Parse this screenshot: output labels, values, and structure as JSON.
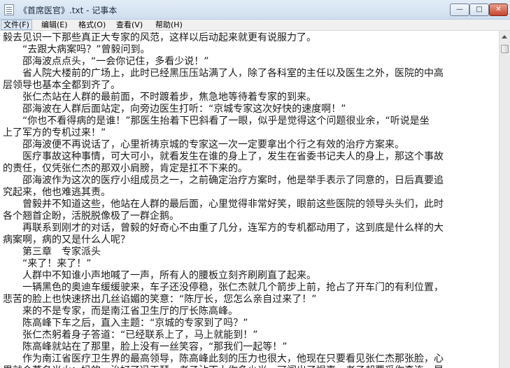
{
  "window": {
    "title": "《首席医官》.txt - 记事本"
  },
  "title_buttons": {
    "minimize": "—",
    "maximize": "□",
    "close": "✕"
  },
  "menu": {
    "items": [
      {
        "label": "文件(F)"
      },
      {
        "label": "编辑(E)"
      },
      {
        "label": "格式(O)"
      },
      {
        "label": "查看(V)"
      },
      {
        "label": "帮助(H)"
      }
    ]
  },
  "editor": {
    "lines": [
      "毅去见识一下那些真正大专家的风范，这样以后动起来就更有说服力了。",
      "　　“去跟大病案吗？”曾毅问到。",
      "　　邵海波点点头，“一会你记住，多看少说！”",
      "　　省人院大楼前的广场上，此时已经黑压压站满了人，除了各科室的主任以及医生之外，医院的中高",
      "层领导也基本全都到齐了。",
      "　　张仁杰站在人群的最前面，不时踱着步，焦急地等待着专家的到来。",
      "　　邵海波在人群后面站定，向旁边医生打听：“京城专家这次好快的速度啊！”",
      "　　“你也不看得病的是谁！”那医生抬着下巴斜看了一眼，似乎是觉得这个问题很业余，“听说是坐",
      "上了军方的专机过来！”",
      "　　邵海波便不再说话了，心里祈祷京城的专家这一次一定要拿出个行之有效的治疗方案来。",
      "　　医疗事故这种事情，可大可小，就看发生在谁的身上了，发生在省委书记夫人的身上，那这个事故",
      "的责任，仅凭张仁杰的那双小肩膀，肯定是扛不下来的。",
      "　　邵海波作为这次的医疗小组成员之一，之前确定治疗方案时，他是举手表示了同意的，日后真要追",
      "究起来，他也难逃其责。",
      "　　曾毅并不知道这些，他站在人群的最后面，心里觉得非常好笑，眼前这些医院的领导头头们，此时",
      "各个翘首企盼，活脱脱像极了一群企鹅。",
      "　　再联系到刚才的对话，曾毅的好奇心不由重了几分，连军方的专机都动用了，这到底是什么样的大",
      "病案啊，病的又是什么人呢？",
      "　　第三章　专家派头",
      "　　“来了！来了！”",
      "　　人群中不知谁小声地喊了一声，所有人的腰板立刻齐刷刷直了起来。",
      "　　一辆黑色的奥迪车缓缓驶来，车子还没停稳，张仁杰就几个箭步上前，抢占了开车门的有利位置，",
      "悲苦的脸上也快速挤出几丝谄媚的笑意：“陈厅长，您怎么亲自过来了！”",
      "　　来的不是专家，而是南江省卫生厅的厅长陈高峰。",
      "　　陈高峰下车之后，直入主题：“京城的专家到了吗？”",
      "　　张仁杰躬着身子答道：“已经联系上了，马上就能到！”",
      "　　陈高峰就站在了那里，脸上没有一丝笑容，“那我们一起等！”",
      "　　作为南江省医疗卫生界的最高领导，陈高峰此刻的压力也很大，他现在只要看见张仁杰那张脸，心",
      "里就会莫名光火：妈的，治好了冯玉琴，老子沾不上你多少光，可闯出了祸事，老子却要受你牵连。早"
    ]
  }
}
